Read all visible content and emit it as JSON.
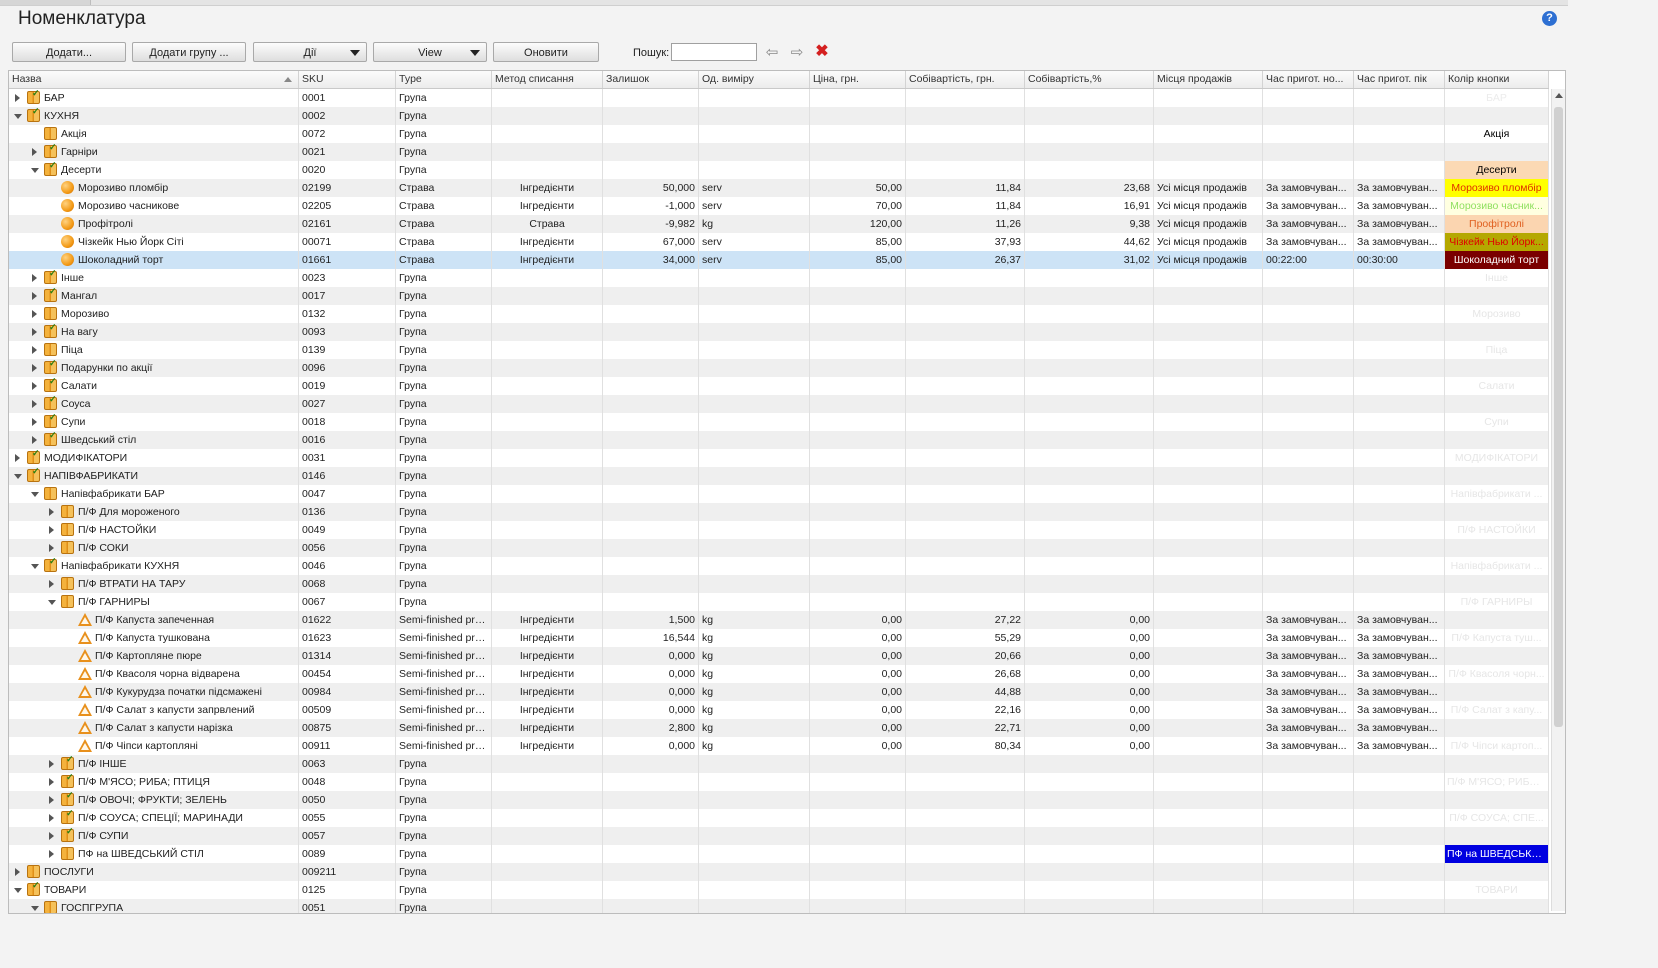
{
  "title": "Номенклатура",
  "help_label": "?",
  "toolbar": {
    "add_label": "Додати...",
    "add_group_label": "Додати групу ...",
    "actions_label": "Дії",
    "view_label": "View",
    "refresh_label": "Оновити",
    "search_label": "Пошук:",
    "search_value": "",
    "back_icon": "⇦",
    "forward_icon": "⇨",
    "clear_icon": "✖"
  },
  "columns": [
    "Назва",
    "SKU",
    "Type",
    "Метод списання",
    "Залишок",
    "Од. виміру",
    "Ціна, грн.",
    "Собівартість, грн.",
    "Собівартість,%",
    "Місця продажів",
    "Час пригот. но...",
    "Час пригот. пік",
    "Колір кнопки"
  ],
  "rows": [
    {
      "level": 0,
      "exp": "c",
      "icon": "folder-check",
      "name": "БАР",
      "sku": "0001",
      "type": "Група",
      "color": {
        "text": "БАР",
        "bg": "",
        "fg": "#ececec"
      }
    },
    {
      "level": 0,
      "exp": "o",
      "icon": "folder-check",
      "name": "КУХНЯ",
      "sku": "0002",
      "type": "Група",
      "color": {
        "text": "",
        "bg": "",
        "fg": ""
      }
    },
    {
      "level": 1,
      "exp": "",
      "icon": "folder",
      "name": "Акція",
      "sku": "0072",
      "type": "Група",
      "color": {
        "text": "Акція",
        "bg": "#ffffff",
        "fg": "#000000"
      }
    },
    {
      "level": 1,
      "exp": "c",
      "icon": "folder-check",
      "name": "Гарніри",
      "sku": "0021",
      "type": "Група",
      "color": {
        "text": "",
        "bg": "",
        "fg": ""
      }
    },
    {
      "level": 1,
      "exp": "o",
      "icon": "folder-check",
      "name": "Десерти",
      "sku": "0020",
      "type": "Група",
      "color": {
        "text": "Десерти",
        "bg": "#fbd9b4",
        "fg": "#000000"
      }
    },
    {
      "level": 2,
      "exp": "",
      "icon": "dish",
      "name": "Морозиво пломбір",
      "sku": "02199",
      "type": "Страва",
      "method": "Інгредієнти",
      "stock": "50,000",
      "unit": "serv",
      "price": "50,00",
      "cost": "11,84",
      "costp": "23,68",
      "places": "Усі місця продажів",
      "tnorm": "За замовчуван...",
      "tpeak": "За замовчуван...",
      "color": {
        "text": "Морозиво пломбір",
        "bg": "#ffff00",
        "fg": "#e03000"
      }
    },
    {
      "level": 2,
      "exp": "",
      "icon": "dish",
      "name": "Морозиво часникове",
      "sku": "02205",
      "type": "Страва",
      "method": "Інгредієнти",
      "stock": "-1,000",
      "unit": "serv",
      "price": "70,00",
      "cost": "11,84",
      "costp": "16,91",
      "places": "Усі місця продажів",
      "tnorm": "За замовчуван...",
      "tpeak": "За замовчуван...",
      "color": {
        "text": "Морозиво часник...",
        "bg": "#ffffe0",
        "fg": "#90e060"
      }
    },
    {
      "level": 2,
      "exp": "",
      "icon": "dish",
      "name": "Профітролі",
      "sku": "02161",
      "type": "Страва",
      "method": "Страва",
      "stock": "-9,982",
      "unit": "kg",
      "price": "120,00",
      "cost": "11,26",
      "costp": "9,38",
      "places": "Усі місця продажів",
      "tnorm": "За замовчуван...",
      "tpeak": "За замовчуван...",
      "color": {
        "text": "Профітролі",
        "bg": "#fbd5b0",
        "fg": "#e06020"
      }
    },
    {
      "level": 2,
      "exp": "",
      "icon": "dish",
      "name": "Чізкейк Нью Йорк Сіті",
      "sku": "00071",
      "type": "Страва",
      "method": "Інгредієнти",
      "stock": "67,000",
      "unit": "serv",
      "price": "85,00",
      "cost": "37,93",
      "costp": "44,62",
      "places": "Усі місця продажів",
      "tnorm": "За замовчуван...",
      "tpeak": "За замовчуван...",
      "color": {
        "text": "Чізкейк Нью Йорк...",
        "bg": "#b5a800",
        "fg": "#e00000"
      }
    },
    {
      "level": 2,
      "exp": "",
      "icon": "dish",
      "name": "Шоколадний торт",
      "sku": "01661",
      "type": "Страва",
      "method": "Інгредієнти",
      "stock": "34,000",
      "unit": "serv",
      "price": "85,00",
      "cost": "26,37",
      "costp": "31,02",
      "places": "Усі місця продажів",
      "tnorm": "00:22:00",
      "tpeak": "00:30:00",
      "selected": true,
      "color": {
        "text": "Шоколадний торт",
        "bg": "#7a0000",
        "fg": "#ffffff"
      }
    },
    {
      "level": 1,
      "exp": "c",
      "icon": "folder-check",
      "name": "Інше",
      "sku": "0023",
      "type": "Група",
      "color": {
        "text": "Інше",
        "bg": "",
        "fg": "#e6e6e6"
      }
    },
    {
      "level": 1,
      "exp": "c",
      "icon": "folder-check",
      "name": "Мангал",
      "sku": "0017",
      "type": "Група",
      "color": {
        "text": "",
        "bg": "",
        "fg": ""
      }
    },
    {
      "level": 1,
      "exp": "c",
      "icon": "folder",
      "name": "Морозиво",
      "sku": "0132",
      "type": "Група",
      "color": {
        "text": "Морозиво",
        "bg": "",
        "fg": "#e6e6e6"
      }
    },
    {
      "level": 1,
      "exp": "c",
      "icon": "folder-check",
      "name": "На вагу",
      "sku": "0093",
      "type": "Група",
      "color": {
        "text": "",
        "bg": "",
        "fg": ""
      }
    },
    {
      "level": 1,
      "exp": "c",
      "icon": "folder",
      "name": "Піца",
      "sku": "0139",
      "type": "Група",
      "color": {
        "text": "Піца",
        "bg": "",
        "fg": "#e6e6e6"
      }
    },
    {
      "level": 1,
      "exp": "c",
      "icon": "folder-check",
      "name": "Подарунки по акції",
      "sku": "0096",
      "type": "Група",
      "color": {
        "text": "",
        "bg": "",
        "fg": ""
      }
    },
    {
      "level": 1,
      "exp": "c",
      "icon": "folder-check",
      "name": "Салати",
      "sku": "0019",
      "type": "Група",
      "color": {
        "text": "Салати",
        "bg": "",
        "fg": "#e6e6e6"
      }
    },
    {
      "level": 1,
      "exp": "c",
      "icon": "folder-check",
      "name": "Соуса",
      "sku": "0027",
      "type": "Група",
      "color": {
        "text": "",
        "bg": "",
        "fg": ""
      }
    },
    {
      "level": 1,
      "exp": "c",
      "icon": "folder-check",
      "name": "Супи",
      "sku": "0018",
      "type": "Група",
      "color": {
        "text": "Супи",
        "bg": "",
        "fg": "#e6e6e6"
      }
    },
    {
      "level": 1,
      "exp": "c",
      "icon": "folder-check",
      "name": "Шведський стіл",
      "sku": "0016",
      "type": "Група",
      "color": {
        "text": "",
        "bg": "",
        "fg": ""
      }
    },
    {
      "level": 0,
      "exp": "c",
      "icon": "folder-check",
      "name": "МОДИФІКАТОРИ",
      "sku": "0031",
      "type": "Група",
      "color": {
        "text": "МОДИФІКАТОРИ",
        "bg": "",
        "fg": "#e6e6e6"
      }
    },
    {
      "level": 0,
      "exp": "o",
      "icon": "folder-check",
      "name": "НАПІВФАБРИКАТИ",
      "sku": "0146",
      "type": "Група",
      "color": {
        "text": "",
        "bg": "",
        "fg": ""
      }
    },
    {
      "level": 1,
      "exp": "o",
      "icon": "folder",
      "name": "Напівфабрикати БАР",
      "sku": "0047",
      "type": "Група",
      "color": {
        "text": "Напівфабрикати ...",
        "bg": "",
        "fg": "#e6e6e6"
      }
    },
    {
      "level": 2,
      "exp": "c",
      "icon": "folder",
      "name": "П/Ф Для мороженого",
      "sku": "0136",
      "type": "Група",
      "color": {
        "text": "",
        "bg": "",
        "fg": ""
      }
    },
    {
      "level": 2,
      "exp": "c",
      "icon": "folder",
      "name": "П/Ф НАСТОЙКИ",
      "sku": "0049",
      "type": "Група",
      "color": {
        "text": "П/Ф НАСТОЙКИ",
        "bg": "",
        "fg": "#e6e6e6"
      }
    },
    {
      "level": 2,
      "exp": "c",
      "icon": "folder",
      "name": "П/Ф СОКИ",
      "sku": "0056",
      "type": "Група",
      "color": {
        "text": "",
        "bg": "",
        "fg": ""
      }
    },
    {
      "level": 1,
      "exp": "o",
      "icon": "folder-check",
      "name": "Напівфабрикати КУХНЯ",
      "sku": "0046",
      "type": "Група",
      "color": {
        "text": "Напівфабрикати ...",
        "bg": "",
        "fg": "#e6e6e6"
      }
    },
    {
      "level": 2,
      "exp": "c",
      "icon": "folder",
      "name": "П/Ф ВТРАТИ НА ТАРУ",
      "sku": "0068",
      "type": "Група",
      "color": {
        "text": "",
        "bg": "",
        "fg": ""
      }
    },
    {
      "level": 2,
      "exp": "o",
      "icon": "folder",
      "name": "П/Ф ГАРНИРЫ",
      "sku": "0067",
      "type": "Група",
      "color": {
        "text": "П/Ф ГАРНИРЫ",
        "bg": "",
        "fg": "#e6e6e6"
      }
    },
    {
      "level": 3,
      "exp": "",
      "icon": "semi",
      "name": "П/Ф Капуста запеченная",
      "sku": "01622",
      "type": "Semi-finished pro...",
      "method": "Інгредієнти",
      "stock": "1,500",
      "unit": "kg",
      "price": "0,00",
      "cost": "27,22",
      "costp": "0,00",
      "places": "",
      "tnorm": "За замовчуван...",
      "tpeak": "За замовчуван...",
      "color": {
        "text": "",
        "bg": "",
        "fg": ""
      }
    },
    {
      "level": 3,
      "exp": "",
      "icon": "semi",
      "name": "П/Ф Капуста тушкована",
      "sku": "01623",
      "type": "Semi-finished pro...",
      "method": "Інгредієнти",
      "stock": "16,544",
      "unit": "kg",
      "price": "0,00",
      "cost": "55,29",
      "costp": "0,00",
      "places": "",
      "tnorm": "За замовчуван...",
      "tpeak": "За замовчуван...",
      "color": {
        "text": "П/Ф Капуста туш...",
        "bg": "",
        "fg": "#e6e6e6"
      }
    },
    {
      "level": 3,
      "exp": "",
      "icon": "semi",
      "name": "П/Ф Картопляне пюре",
      "sku": "01314",
      "type": "Semi-finished pro...",
      "method": "Інгредієнти",
      "stock": "0,000",
      "unit": "kg",
      "price": "0,00",
      "cost": "20,66",
      "costp": "0,00",
      "places": "",
      "tnorm": "За замовчуван...",
      "tpeak": "За замовчуван...",
      "color": {
        "text": "",
        "bg": "",
        "fg": ""
      }
    },
    {
      "level": 3,
      "exp": "",
      "icon": "semi",
      "name": "П/Ф Квасоля чорна відварена",
      "sku": "00454",
      "type": "Semi-finished pro...",
      "method": "Інгредієнти",
      "stock": "0,000",
      "unit": "kg",
      "price": "0,00",
      "cost": "26,68",
      "costp": "0,00",
      "places": "",
      "tnorm": "За замовчуван...",
      "tpeak": "За замовчуван...",
      "color": {
        "text": "П/Ф Квасоля чорн...",
        "bg": "",
        "fg": "#e6e6e6"
      }
    },
    {
      "level": 3,
      "exp": "",
      "icon": "semi",
      "name": "П/Ф Кукурудза початки підсмажені",
      "sku": "00984",
      "type": "Semi-finished pro...",
      "method": "Інгредієнти",
      "stock": "0,000",
      "unit": "kg",
      "price": "0,00",
      "cost": "44,88",
      "costp": "0,00",
      "places": "",
      "tnorm": "За замовчуван...",
      "tpeak": "За замовчуван...",
      "color": {
        "text": "",
        "bg": "",
        "fg": ""
      }
    },
    {
      "level": 3,
      "exp": "",
      "icon": "semi",
      "name": "П/Ф Салат з капусти запрвлений",
      "sku": "00509",
      "type": "Semi-finished pro...",
      "method": "Інгредієнти",
      "stock": "0,000",
      "unit": "kg",
      "price": "0,00",
      "cost": "22,16",
      "costp": "0,00",
      "places": "",
      "tnorm": "За замовчуван...",
      "tpeak": "За замовчуван...",
      "color": {
        "text": "П/Ф Салат з капу...",
        "bg": "",
        "fg": "#e6e6e6"
      }
    },
    {
      "level": 3,
      "exp": "",
      "icon": "semi",
      "name": "П/Ф Салат з капусти нарізка",
      "sku": "00875",
      "type": "Semi-finished pro...",
      "method": "Інгредієнти",
      "stock": "2,800",
      "unit": "kg",
      "price": "0,00",
      "cost": "22,71",
      "costp": "0,00",
      "places": "",
      "tnorm": "За замовчуван...",
      "tpeak": "За замовчуван...",
      "color": {
        "text": "",
        "bg": "",
        "fg": ""
      }
    },
    {
      "level": 3,
      "exp": "",
      "icon": "semi",
      "name": "П/Ф Чіпси картопляні",
      "sku": "00911",
      "type": "Semi-finished pro...",
      "method": "Інгредієнти",
      "stock": "0,000",
      "unit": "kg",
      "price": "0,00",
      "cost": "80,34",
      "costp": "0,00",
      "places": "",
      "tnorm": "За замовчуван...",
      "tpeak": "За замовчуван...",
      "color": {
        "text": "П/Ф Чіпси картоп...",
        "bg": "",
        "fg": "#e6e6e6"
      }
    },
    {
      "level": 2,
      "exp": "c",
      "icon": "folder-check",
      "name": "П/Ф ІНШЕ",
      "sku": "0063",
      "type": "Група",
      "color": {
        "text": "",
        "bg": "",
        "fg": ""
      }
    },
    {
      "level": 2,
      "exp": "c",
      "icon": "folder-check",
      "name": "П/Ф М'ЯСО; РИБА; ПТИЦЯ",
      "sku": "0048",
      "type": "Група",
      "color": {
        "text": "П/Ф М'ЯСО; РИБА;...",
        "bg": "",
        "fg": "#e6e6e6"
      }
    },
    {
      "level": 2,
      "exp": "c",
      "icon": "folder-check",
      "name": "П/Ф ОВОЧІ; ФРУКТИ; ЗЕЛЕНЬ",
      "sku": "0050",
      "type": "Група",
      "color": {
        "text": "",
        "bg": "",
        "fg": ""
      }
    },
    {
      "level": 2,
      "exp": "c",
      "icon": "folder-check",
      "name": "П/Ф СОУСА; СПЕЦІЇ; МАРИНАДИ",
      "sku": "0055",
      "type": "Група",
      "color": {
        "text": "П/Ф СОУСА; СПЕ...",
        "bg": "",
        "fg": "#e6e6e6"
      }
    },
    {
      "level": 2,
      "exp": "c",
      "icon": "folder-check",
      "name": "П/Ф СУПИ",
      "sku": "0057",
      "type": "Група",
      "color": {
        "text": "",
        "bg": "",
        "fg": ""
      }
    },
    {
      "level": 2,
      "exp": "c",
      "icon": "folder",
      "name": "ПФ на ШВЕДСЬКИЙ СТІЛ",
      "sku": "0089",
      "type": "Група",
      "color": {
        "text": "ПФ на ШВЕДСЬКИ...",
        "bg": "#0000e0",
        "fg": "#ffffff"
      }
    },
    {
      "level": 0,
      "exp": "c",
      "icon": "folder",
      "name": "ПОСЛУГИ",
      "sku": "009211",
      "type": "Група",
      "color": {
        "text": "",
        "bg": "",
        "fg": ""
      }
    },
    {
      "level": 0,
      "exp": "o",
      "icon": "folder-check",
      "name": "ТОВАРИ",
      "sku": "0125",
      "type": "Група",
      "color": {
        "text": "ТОВАРИ",
        "bg": "",
        "fg": "#e6e6e6"
      }
    },
    {
      "level": 1,
      "exp": "o",
      "icon": "folder",
      "name": "ГОСПГРУПА",
      "sku": "0051",
      "type": "Група",
      "color": {
        "text": "",
        "bg": "",
        "fg": ""
      }
    }
  ]
}
